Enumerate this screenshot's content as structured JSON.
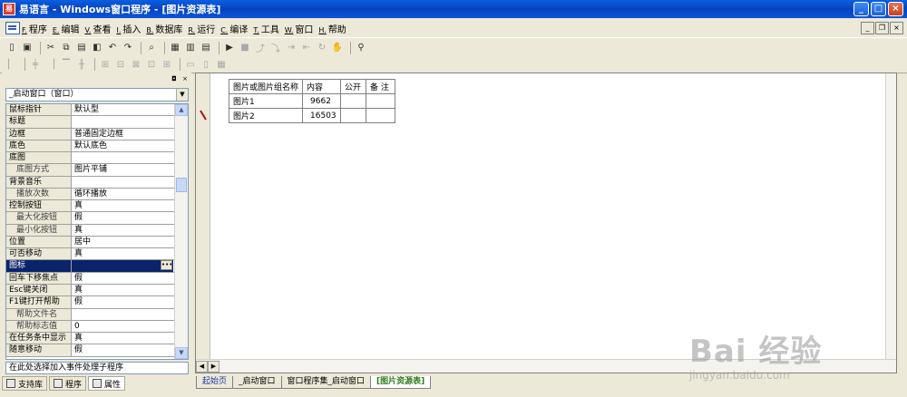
{
  "window": {
    "title": "易语言 - Windows窗口程序 - [图片资源表]",
    "minimize": "_",
    "maximize": "□",
    "close": "×"
  },
  "menu": {
    "items": [
      {
        "key": "F.",
        "label": "程序"
      },
      {
        "key": "E.",
        "label": "编辑"
      },
      {
        "key": "V.",
        "label": "查看"
      },
      {
        "key": "I.",
        "label": "插入"
      },
      {
        "key": "B.",
        "label": "数据库"
      },
      {
        "key": "R.",
        "label": "运行"
      },
      {
        "key": "C.",
        "label": "编译"
      },
      {
        "key": "T.",
        "label": "工具"
      },
      {
        "key": "W.",
        "label": "窗口"
      },
      {
        "key": "H.",
        "label": "帮助"
      }
    ]
  },
  "property_panel": {
    "selector_value": "_启动窗口（窗口）",
    "rows": [
      {
        "name": "鼠标指针",
        "value": "默认型"
      },
      {
        "name": "标题",
        "value": ""
      },
      {
        "name": "边框",
        "value": "普通固定边框"
      },
      {
        "name": "底色",
        "value": "默认底色"
      },
      {
        "name": "底图",
        "value": ""
      },
      {
        "name": "底图方式",
        "value": "图片平铺"
      },
      {
        "name": "背景音乐",
        "value": ""
      },
      {
        "name": "播放次数",
        "value": "循环播放"
      },
      {
        "name": "控制按钮",
        "value": "真"
      },
      {
        "name": "最大化按钮",
        "value": "假"
      },
      {
        "name": "最小化按钮",
        "value": "真"
      },
      {
        "name": "位置",
        "value": "居中"
      },
      {
        "name": "可否移动",
        "value": "真"
      },
      {
        "name": "图标",
        "value": ""
      },
      {
        "name": "回车下移焦点",
        "value": "假"
      },
      {
        "name": "Esc键关闭",
        "value": "真"
      },
      {
        "name": "F1键打开帮助",
        "value": "假"
      },
      {
        "name": "帮助文件名",
        "value": ""
      },
      {
        "name": "帮助标志值",
        "value": "0"
      },
      {
        "name": "在任务条中显示",
        "value": "真"
      },
      {
        "name": "随意移动",
        "value": "假"
      }
    ],
    "hint": "在此处选择加入事件处理子程序"
  },
  "left_tabs": {
    "support": "支持库",
    "program": "程序",
    "property": "属性"
  },
  "resource_table": {
    "headers": [
      "图片或图片组名称",
      "内容",
      "公开",
      "备 注"
    ],
    "rows": [
      [
        "图片1",
        "9662",
        "",
        ""
      ],
      [
        "图片2",
        "16503",
        "",
        ""
      ]
    ]
  },
  "doc_tabs": [
    "起始页",
    "_启动窗口",
    "窗口程序集_启动窗口",
    "[图片资源表]"
  ],
  "watermark": {
    "main": "Bai 经验",
    "sub": "jingyan.baidu.com"
  }
}
